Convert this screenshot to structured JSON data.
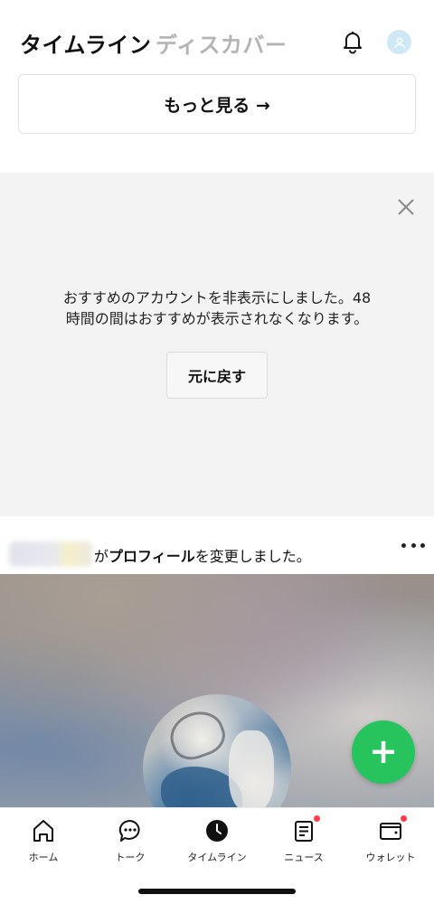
{
  "header": {
    "tab_active": "タイムライン",
    "tab_inactive": "ディスカバー",
    "icons": {
      "notifications": "bell-icon",
      "profile": "avatar-icon"
    }
  },
  "more_button": {
    "label": "もっと見る →"
  },
  "hidden_notice": {
    "message_line1": "おすすめのアカウントを非表示にしました。48",
    "message_line2": "時間の間はおすすめが表示されなくなります。",
    "undo_label": "元に戻す",
    "close_icon": "close-icon"
  },
  "post": {
    "action_prefix": "が",
    "action_bold": "プロフィール",
    "action_suffix": "を変更しました。",
    "menu_icon": "more-dots-icon"
  },
  "fab": {
    "label": "+",
    "color": "#27c45e"
  },
  "bottom_nav": {
    "items": [
      {
        "label": "ホーム",
        "icon": "home-icon",
        "badge": false
      },
      {
        "label": "トーク",
        "icon": "chat-icon",
        "badge": false
      },
      {
        "label": "タイムライン",
        "icon": "clock-icon",
        "badge": false
      },
      {
        "label": "ニュース",
        "icon": "news-icon",
        "badge": true
      },
      {
        "label": "ウォレット",
        "icon": "wallet-icon",
        "badge": true
      }
    ],
    "badge_color": "#ff3b45"
  }
}
